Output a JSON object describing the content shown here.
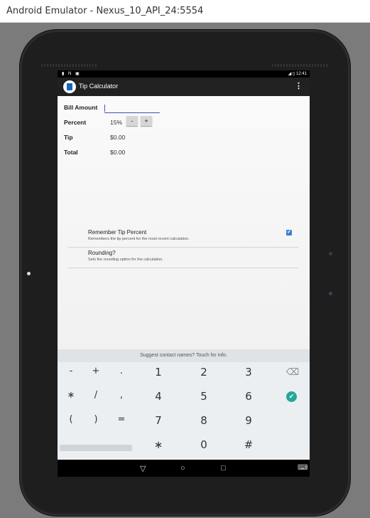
{
  "window": {
    "title": "Android Emulator - Nexus_10_API_24:5554"
  },
  "status_bar": {
    "left_icons": "▮ N ▣",
    "time": "12:41",
    "right_icons": "◢ ▯"
  },
  "action_bar": {
    "title": "Tip Calculator",
    "overflow": "⋮",
    "icon": "calculator-icon"
  },
  "form": {
    "bill_amount_label": "Bill Amount",
    "bill_amount_value": "",
    "percent_label": "Percent",
    "percent_value": "15%",
    "decrement_label": "-",
    "increment_label": "+",
    "tip_label": "Tip",
    "tip_value": "$0.00",
    "total_label": "Total",
    "total_value": "$0.00"
  },
  "settings": [
    {
      "title": "Remember Tip Percent",
      "summary": "Remembers the tip percent for the most recent calculation.",
      "checked": "✔"
    },
    {
      "title": "Rounding?",
      "summary": "Sets the rounding option for the calculation."
    }
  ],
  "keyboard": {
    "suggestion": "Suggest contact names? Touch for info.",
    "row1": [
      "-",
      "+",
      ".",
      "1",
      "2",
      "3"
    ],
    "row2": [
      "∗",
      "/",
      ",",
      "4",
      "5",
      "6"
    ],
    "row3": [
      "(",
      ")",
      "=",
      "7",
      "8",
      "9"
    ],
    "row4": [
      "∗",
      "0",
      "#"
    ],
    "backspace": "⌫",
    "done": "✔"
  },
  "nav_bar": {
    "back": "▽",
    "home": "○",
    "recents": "□",
    "keyboard": "⌨"
  },
  "colors": {
    "accent": "#3f51b5",
    "done_key": "#26a69a",
    "action_bar": "#212121"
  }
}
